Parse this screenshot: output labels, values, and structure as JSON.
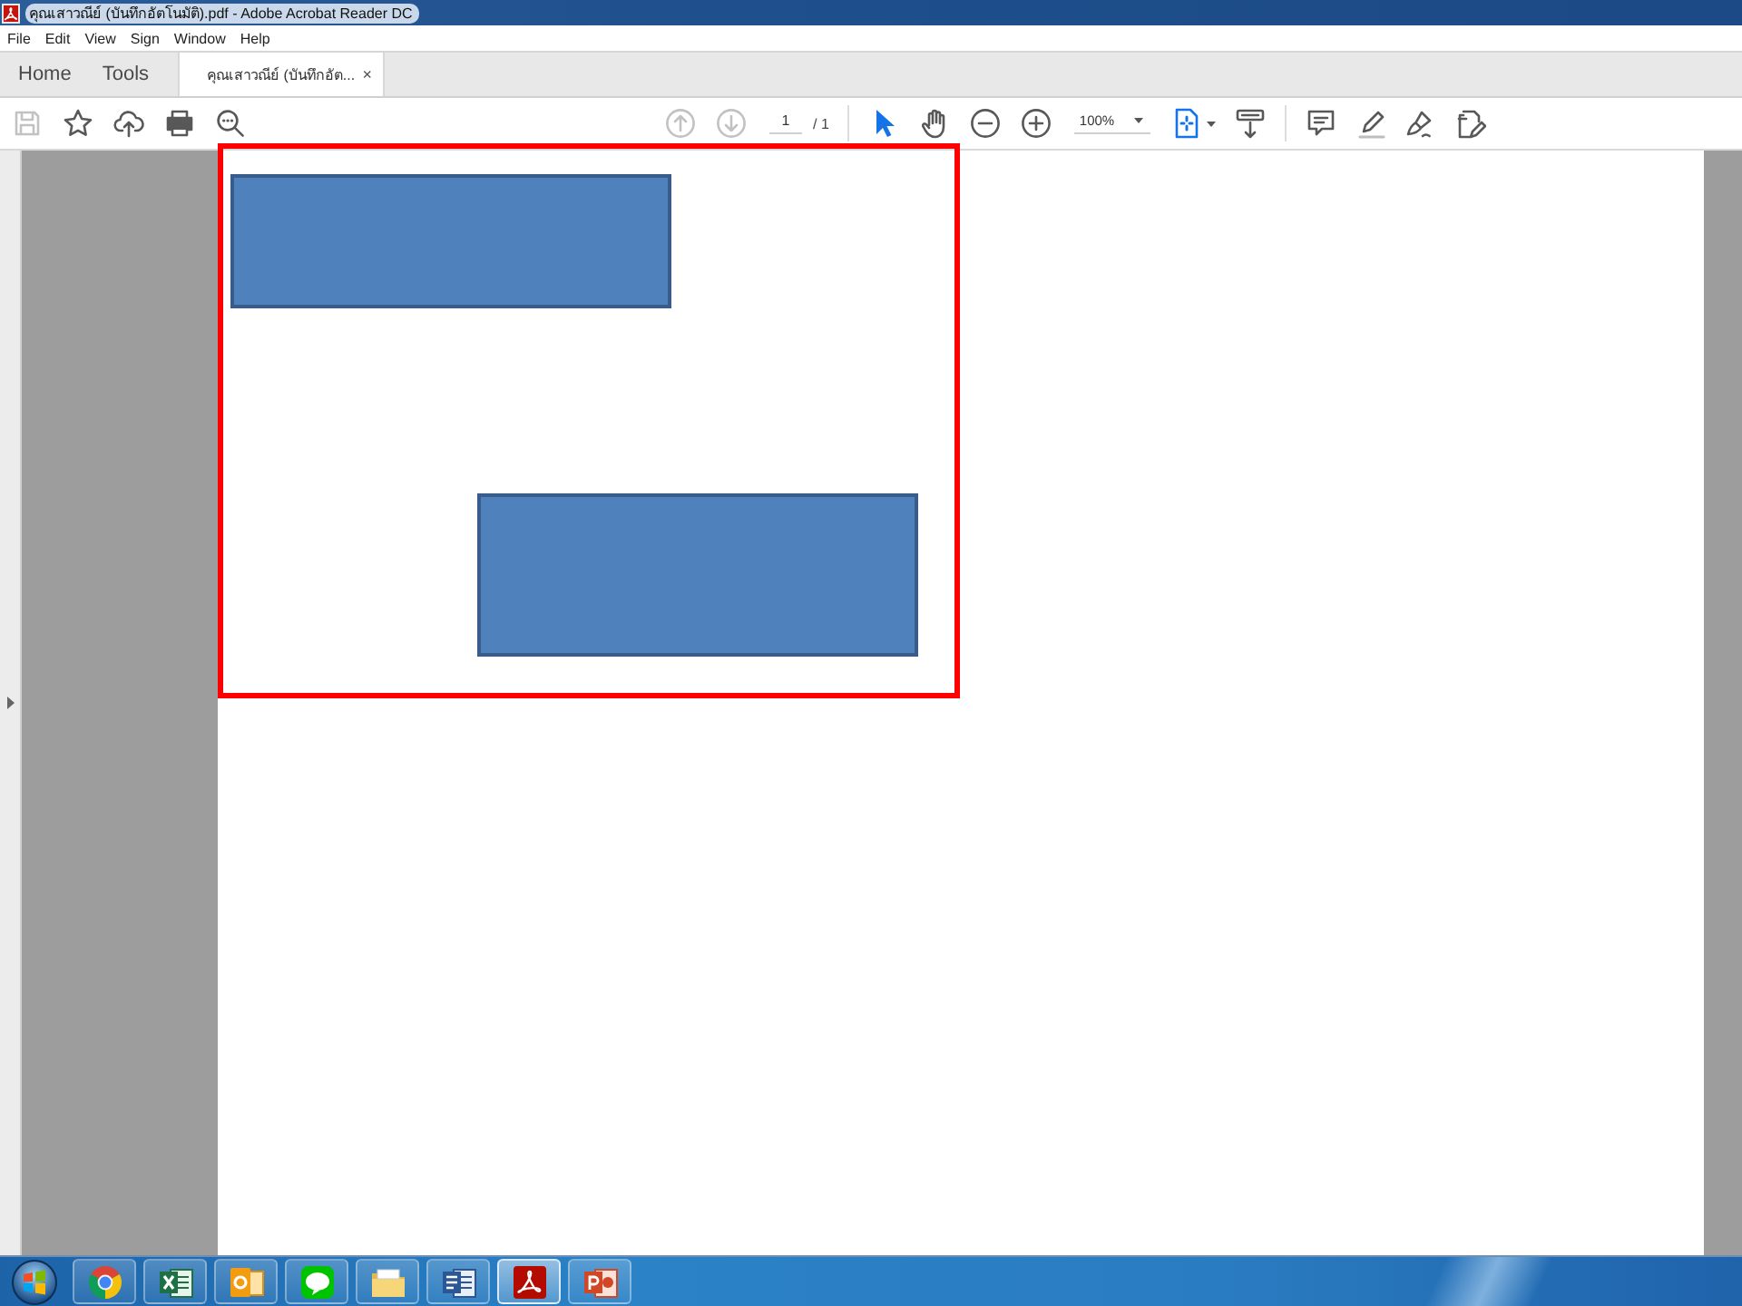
{
  "window": {
    "title": "คุณเสาวณีย์ (บันทึกอัตโนมัติ).pdf - Adobe Acrobat Reader DC"
  },
  "menu": [
    "File",
    "Edit",
    "View",
    "Sign",
    "Window",
    "Help"
  ],
  "tabs": [
    {
      "label": "Home",
      "selected": false,
      "kind": "nav"
    },
    {
      "label": "Tools",
      "selected": false,
      "kind": "nav"
    },
    {
      "label": "คุณเสาวณีย์ (บันทึกอัต...",
      "selected": true,
      "kind": "document",
      "close": "×"
    }
  ],
  "toolbar": {
    "file_buttons": [
      {
        "disabled": true
      },
      {
        "disabled": false
      },
      {
        "disabled": false
      },
      {
        "disabled": false
      },
      {
        "disabled": false
      }
    ],
    "page_buttons": [
      {
        "disabled": true
      },
      {
        "disabled": true
      }
    ],
    "page_number": "1",
    "page_total": "/ 1",
    "tools": [
      {
        "selected": true
      },
      {
        "selected": false
      }
    ],
    "zoom": "100%"
  },
  "document_page": {
    "shapes": [
      {
        "kind": "outline",
        "color": "#ff0000"
      },
      {
        "kind": "filled",
        "color": "#4f81bd"
      },
      {
        "kind": "filled",
        "color": "#4f81bd"
      }
    ]
  },
  "taskbar": {
    "items": [
      {
        "kind": "browser",
        "selected": false
      },
      {
        "kind": "spreadsheet",
        "selected": false
      },
      {
        "kind": "mail",
        "selected": false
      },
      {
        "kind": "chat",
        "selected": false
      },
      {
        "kind": "folder",
        "selected": false
      },
      {
        "kind": "document",
        "selected": false
      },
      {
        "kind": "pdf",
        "selected": true
      },
      {
        "kind": "slides",
        "selected": false
      }
    ]
  }
}
